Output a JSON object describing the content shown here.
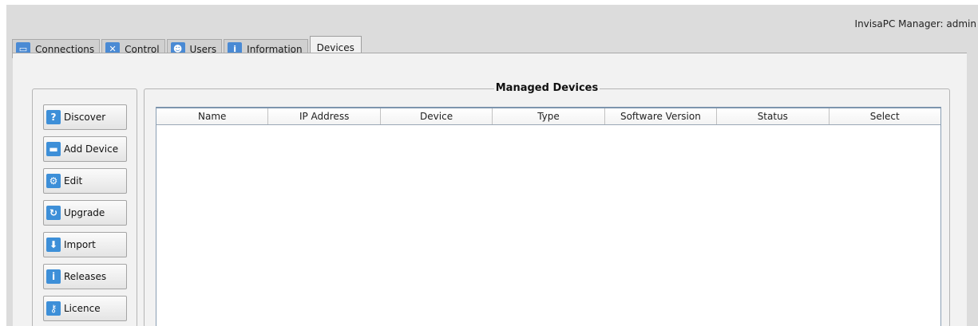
{
  "header": {
    "user_label": "InvisaPC Manager: admin"
  },
  "tabs": [
    {
      "label": "Connections",
      "icon": "monitor-icon",
      "glyph": "▭"
    },
    {
      "label": "Control",
      "icon": "tools-icon",
      "glyph": "✕"
    },
    {
      "label": "Users",
      "icon": "users-icon",
      "glyph": "☻"
    },
    {
      "label": "Information",
      "icon": "info-icon",
      "glyph": "i"
    },
    {
      "label": "Devices",
      "icon": "",
      "glyph": ""
    }
  ],
  "toolbar": {
    "buttons": [
      {
        "label": "Discover",
        "icon": "question-icon",
        "glyph": "?"
      },
      {
        "label": "Add Device",
        "icon": "add-device-icon",
        "glyph": "▬"
      },
      {
        "label": "Edit",
        "icon": "gear-icon",
        "glyph": "⚙"
      },
      {
        "label": "Upgrade",
        "icon": "refresh-icon",
        "glyph": "↻"
      },
      {
        "label": "Import",
        "icon": "download-icon",
        "glyph": "⬇"
      },
      {
        "label": "Releases",
        "icon": "info-icon",
        "glyph": "i"
      },
      {
        "label": "Licence",
        "icon": "key-icon",
        "glyph": "⚷"
      }
    ]
  },
  "managed_devices": {
    "title": "Managed Devices",
    "columns": [
      "Name",
      "IP Address",
      "Device",
      "Type",
      "Software Version",
      "Status",
      "Select"
    ],
    "rows": []
  },
  "colors": {
    "accent": "#3d8fd8",
    "background": "#dcdcdc",
    "panel": "#f2f2f2"
  }
}
